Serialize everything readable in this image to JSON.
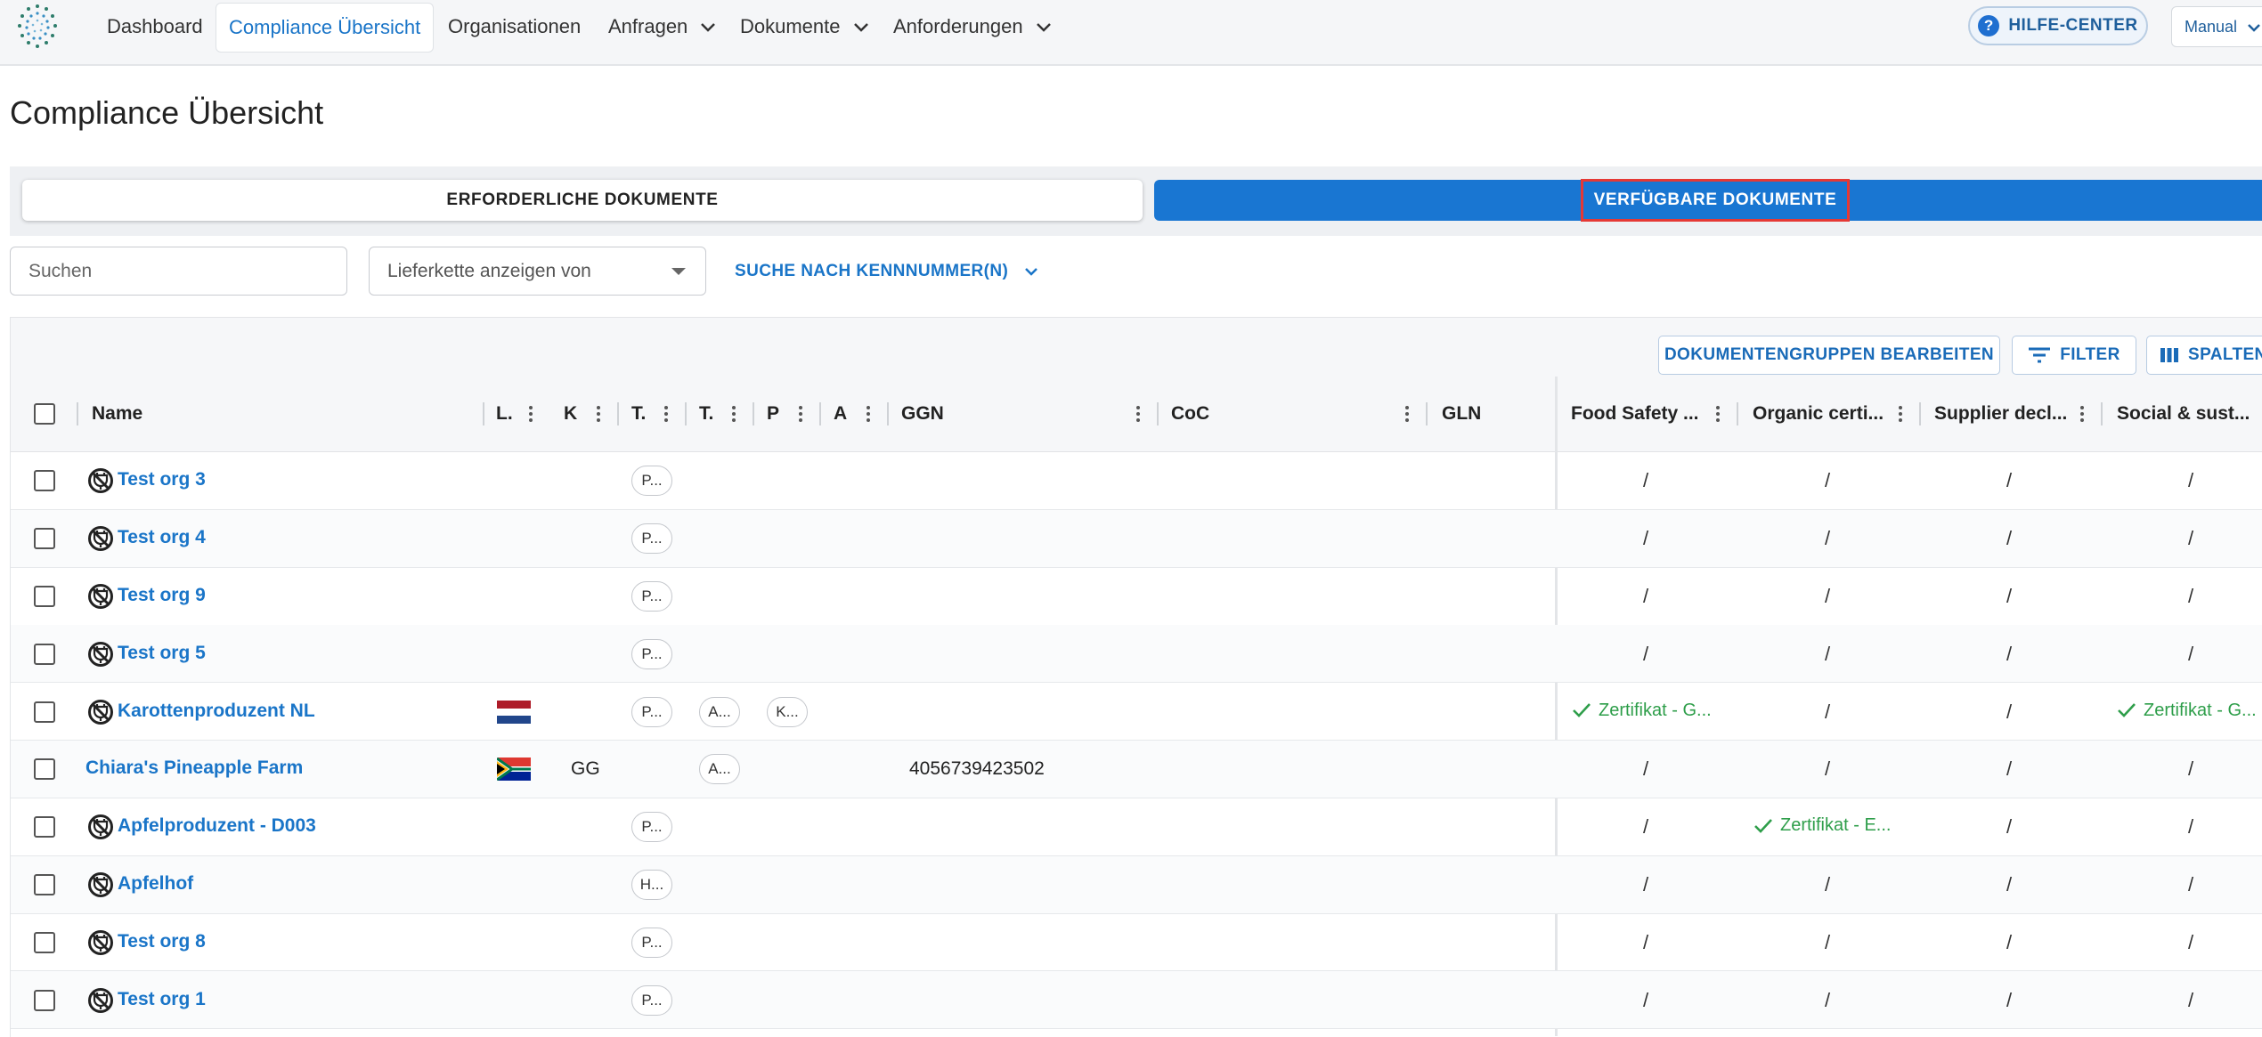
{
  "nav": {
    "items": [
      {
        "label": "Dashboard"
      },
      {
        "label": "Compliance Übersicht"
      },
      {
        "label": "Organisationen"
      },
      {
        "label": "Anfragen"
      },
      {
        "label": "Dokumente"
      },
      {
        "label": "Anforderungen"
      }
    ],
    "help_label": "HILFE-CENTER",
    "mode_value": "Manual"
  },
  "page": {
    "title": "Compliance Übersicht"
  },
  "tabs": {
    "required": "ERFORDERLICHE DOKUMENTE",
    "available": "VERFÜGBARE DOKUMENTE"
  },
  "filters": {
    "search_placeholder": "Suchen",
    "supply_chain_placeholder": "Lieferkette anzeigen von",
    "id_search_label": "SUCHE NACH KENNNUMMER(N)"
  },
  "toolbar": {
    "edit_groups": "DOKUMENTENGRUPPEN BEARBEITEN",
    "filter": "FILTER",
    "columns": "SPALTEN"
  },
  "columns": {
    "name": "Name",
    "l": "L.",
    "k": "K",
    "t1": "T.",
    "t2": "T.",
    "p": "P",
    "a": "A",
    "ggn": "GGN",
    "coc": "CoC",
    "gln": "GLN",
    "doc1": "Food Safety ...",
    "doc2": "Organic certi...",
    "doc3": "Supplier decl...",
    "doc4": "Social & sust..."
  },
  "rows": [
    {
      "name": "Test org 3",
      "chips": [
        "P..."
      ],
      "ggn": "",
      "docs": [
        "/",
        "/",
        "/",
        "/"
      ]
    },
    {
      "name": "Test org 4",
      "chips": [
        "P..."
      ],
      "ggn": "",
      "docs": [
        "/",
        "/",
        "/",
        "/"
      ]
    },
    {
      "name": "Test org 9",
      "chips": [
        "P..."
      ],
      "ggn": "",
      "docs": [
        "/",
        "/",
        "/",
        "/"
      ]
    },
    {
      "name": "Test org 5",
      "chips": [
        "P..."
      ],
      "ggn": "",
      "docs": [
        "/",
        "/",
        "/",
        "/"
      ]
    },
    {
      "name": "Karottenproduzent NL",
      "flag": "NL",
      "chips": [
        "P...",
        "A...",
        "K..."
      ],
      "ggn": "",
      "docs": [
        "Zertifikat - G...",
        "/",
        "/",
        "Zertifikat - G..."
      ]
    },
    {
      "name": "Chiara's Pineapple Farm",
      "flag": "ZA",
      "k": "GG",
      "chips": [
        "A..."
      ],
      "ggn": "4056739423502",
      "docs": [
        "/",
        "/",
        "/",
        "/"
      ]
    },
    {
      "name": "Apfelproduzent - D003",
      "chips": [
        "P..."
      ],
      "ggn": "",
      "docs": [
        "/",
        "Zertifikat - E...",
        "/",
        "/"
      ]
    },
    {
      "name": "Apfelhof",
      "chips": [
        "H..."
      ],
      "ggn": "",
      "docs": [
        "/",
        "/",
        "/",
        "/"
      ]
    },
    {
      "name": "Test org 8",
      "chips": [
        "P..."
      ],
      "ggn": "",
      "docs": [
        "/",
        "/",
        "/",
        "/"
      ]
    },
    {
      "name": "Test org 1",
      "chips": [
        "P..."
      ],
      "ggn": "",
      "docs": [
        "/",
        "/",
        "/",
        "/"
      ]
    }
  ],
  "colors": {
    "accent": "#1976d2",
    "link": "#1a75c8",
    "success": "#2e9e4a",
    "highlight": "#e53935"
  }
}
